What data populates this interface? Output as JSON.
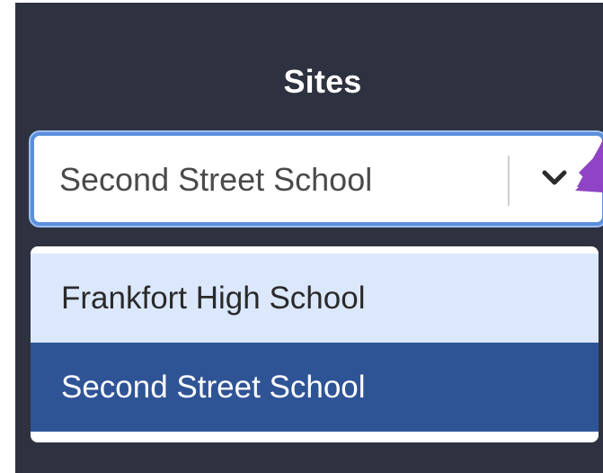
{
  "sites": {
    "title": "Sites",
    "selected_value": "Second Street School",
    "options": [
      {
        "label": "Frankfort High School",
        "state": "hover"
      },
      {
        "label": "Second Street School",
        "state": "selected"
      }
    ]
  },
  "icons": {
    "dropdown_toggle": "chevron-down-icon",
    "annotation": "arrow-pointer-icon"
  },
  "colors": {
    "panel_bg": "#2e3240",
    "focus_border": "#5b8fdc",
    "option_hover_bg": "#dbe8fc",
    "option_selected_bg": "#2f5496",
    "annotation_arrow": "#8e44c4"
  }
}
